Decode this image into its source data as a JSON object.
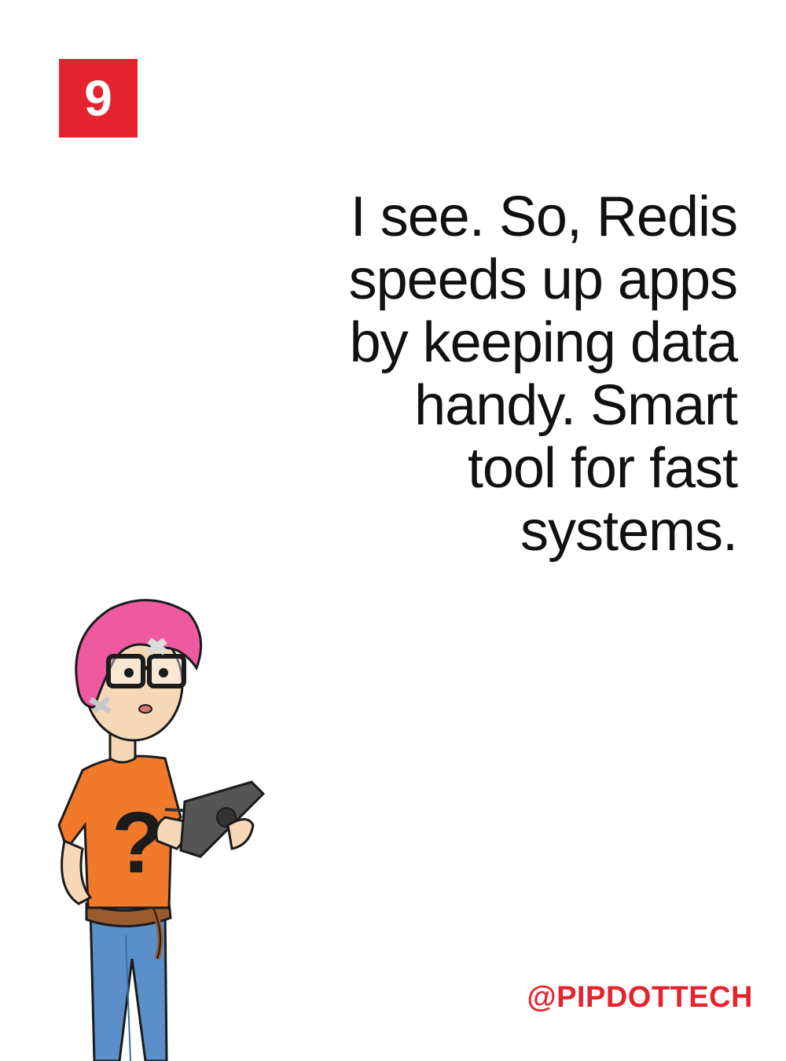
{
  "slide": {
    "number": "9",
    "quote_lines": [
      "I see. So, Redis",
      "speeds up apps",
      "by keeping data",
      "handy. Smart",
      "tool for fast",
      "systems."
    ],
    "handle": "@PIPDOTTECH"
  },
  "colors": {
    "accent": "#e5232e",
    "text": "#111111",
    "background": "#ffffff"
  },
  "character": {
    "icon": "character-illustration",
    "hair_color": "#ee5a9f",
    "shirt_color": "#f07a2a",
    "jeans_color": "#5b8fc9"
  }
}
